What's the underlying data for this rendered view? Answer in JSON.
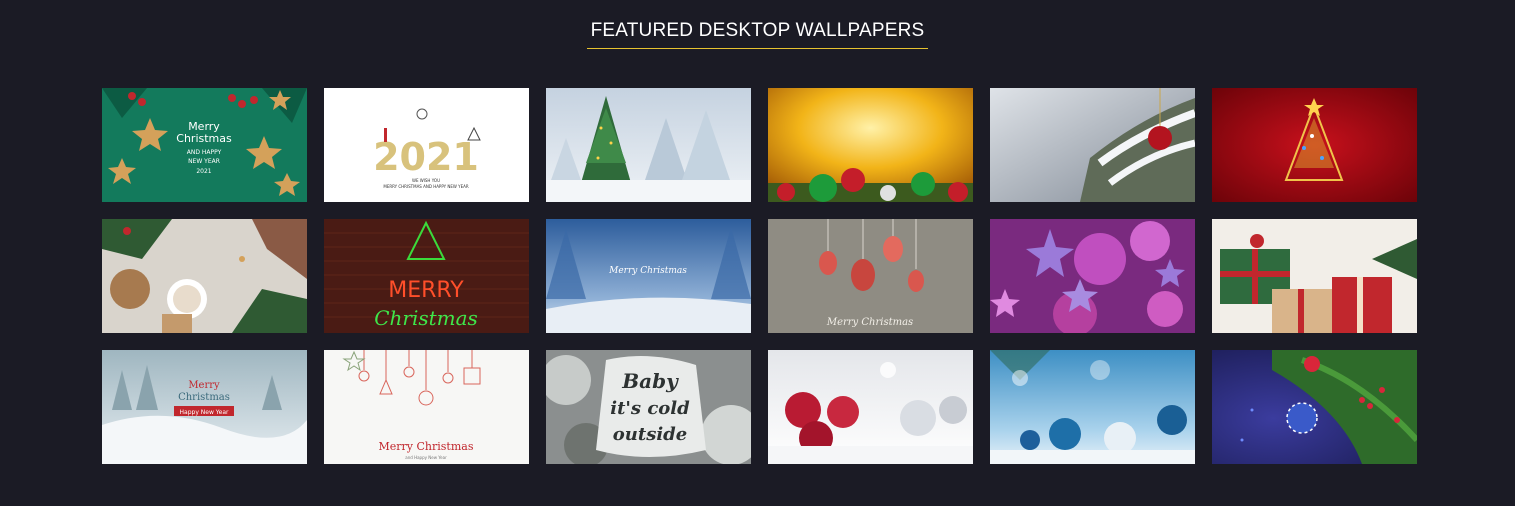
{
  "section": {
    "title": "FEATURED DESKTOP WALLPAPERS",
    "accent_color": "#e6c22f",
    "background_color": "#1b1b25"
  },
  "wallpapers": [
    {
      "lines": [
        "Merry",
        "Christmas",
        "AND HAPPY",
        "NEW YEAR",
        "2021"
      ]
    },
    {
      "lines": [
        "2021",
        "WE WISH YOU",
        "MERRY CHRISTMAS AND HAPPY NEW YEAR"
      ]
    },
    {
      "lines": []
    },
    {
      "lines": []
    },
    {
      "lines": []
    },
    {
      "lines": []
    },
    {
      "lines": []
    },
    {
      "lines": [
        "MERRY",
        "Christmas"
      ]
    },
    {
      "lines": [
        "Merry Christmas"
      ]
    },
    {
      "lines": [
        "Merry Christmas"
      ]
    },
    {
      "lines": []
    },
    {
      "lines": []
    },
    {
      "lines": [
        "Merry",
        "Christmas",
        "Happy New Year"
      ]
    },
    {
      "lines": [
        "Merry Christmas",
        "and Happy New Year"
      ]
    },
    {
      "lines": [
        "Baby",
        "it's cold",
        "outside"
      ]
    },
    {
      "lines": []
    },
    {
      "lines": []
    },
    {
      "lines": []
    }
  ]
}
